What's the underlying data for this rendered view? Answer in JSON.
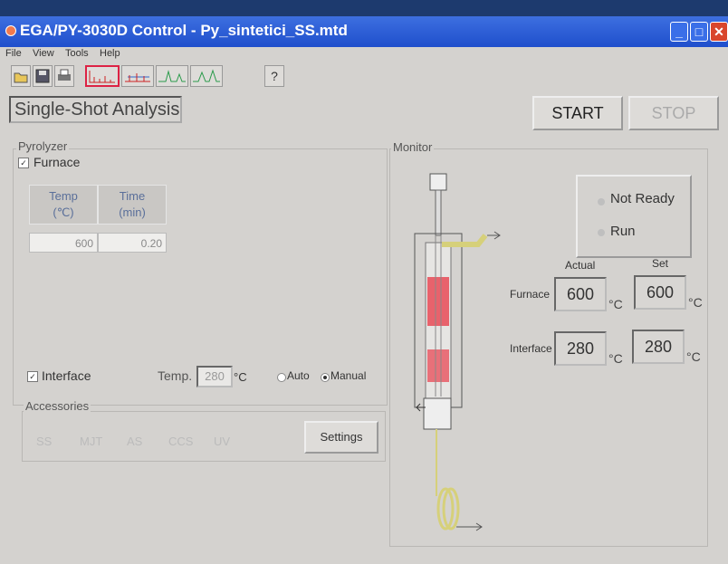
{
  "window": {
    "title": "EGA/PY-3030D Control - Py_sintetici_SS.mtd"
  },
  "menu": {
    "file": "File",
    "view": "View",
    "tools": "Tools",
    "help": "Help"
  },
  "toolbar": {
    "help_glyph": "?"
  },
  "header": {
    "mode": "Single-Shot Analysis",
    "start": "START",
    "stop": "STOP"
  },
  "pyrolyzer": {
    "group": "Pyrolyzer",
    "furnace_label": "Furnace",
    "col_temp": "Temp",
    "col_temp_unit": "(℃)",
    "col_time": "Time",
    "col_time_unit": "(min)",
    "temp_value": "600",
    "time_value": "0.20",
    "interface_label": "Interface",
    "temp_label": "Temp.",
    "interface_temp": "280",
    "interface_temp_unit": "°C",
    "auto_label": "Auto",
    "manual_label": "Manual"
  },
  "accessories": {
    "group": "Accessories",
    "items": [
      "SS",
      "MJT",
      "AS",
      "CCS",
      "UV"
    ],
    "settings": "Settings"
  },
  "monitor": {
    "group": "Monitor",
    "not_ready": "Not Ready",
    "run": "Run",
    "actual_header": "Actual",
    "set_header": "Set",
    "furnace_label": "Furnace",
    "furnace_actual": "600",
    "furnace_set": "600",
    "interface_label": "Interface",
    "interface_actual": "280",
    "interface_set": "280",
    "unit": "°C"
  },
  "colors": {
    "titlebar": "#1f4fcc",
    "heater": "#e8535e",
    "gas_line": "#e6e07a"
  }
}
